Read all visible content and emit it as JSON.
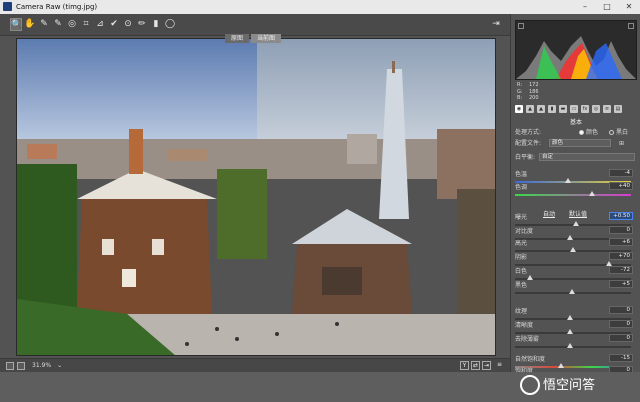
{
  "window": {
    "title": "Camera Raw (timg.jpg)"
  },
  "toolbar": {
    "tools": [
      "zoom-tool",
      "hand-tool",
      "white-balance-tool",
      "color-sampler-tool",
      "targeted-adjustment-tool",
      "crop-tool",
      "straighten-tool",
      "spot-removal-tool",
      "red-eye-tool",
      "adjustment-brush-tool",
      "graduated-filter-tool",
      "radial-filter-tool"
    ],
    "glyphs": [
      "🔍",
      "✋",
      "✎",
      "✎",
      "◎",
      "⌗",
      "⊿",
      "✔",
      "⊙",
      "✏",
      "▮",
      "◯"
    ]
  },
  "view": {
    "before_label": "原图",
    "after_label": "当前图",
    "zoom": "31.9%"
  },
  "histogram": {
    "r_label": "R:",
    "g_label": "G:",
    "b_label": "B:",
    "r": "172",
    "g": "186",
    "b": "200"
  },
  "panel": {
    "section_title": "基本",
    "treatment_label": "处理方式:",
    "color_option": "颜色",
    "bw_option": "黑白",
    "profile_label": "配置文件:",
    "profile_value": "颜色",
    "wb_label": "白平衡:",
    "wb_value": "自定",
    "auto_label": "自动",
    "default_label": "默认值"
  },
  "sliders": [
    {
      "label": "色温",
      "value": "-4",
      "level": 0.48
    },
    {
      "label": "色调",
      "value": "+40",
      "level": 0.7
    },
    {
      "label": "曝光",
      "value": "+0.50",
      "level": 0.55,
      "highlight": true
    },
    {
      "label": "对比度",
      "value": "0",
      "level": 0.5
    },
    {
      "label": "高光",
      "value": "+6",
      "level": 0.53
    },
    {
      "label": "阴影",
      "value": "+70",
      "level": 0.85
    },
    {
      "label": "白色",
      "value": "-72",
      "level": 0.14
    },
    {
      "label": "黑色",
      "value": "+5",
      "level": 0.52
    },
    {
      "label": "纹理",
      "value": "0",
      "level": 0.5
    },
    {
      "label": "清晰度",
      "value": "0",
      "level": 0.5
    },
    {
      "label": "去除薄雾",
      "value": "0",
      "level": 0.5
    },
    {
      "label": "自然饱和度",
      "value": "-15",
      "level": 0.42
    },
    {
      "label": "饱和度",
      "value": "0",
      "level": 0.5
    }
  ],
  "watermark": {
    "text": "悟空问答"
  },
  "colors": {
    "accent": "#4a84e8",
    "panel_bg": "#535353",
    "title_bg": "#e9e9e9"
  }
}
